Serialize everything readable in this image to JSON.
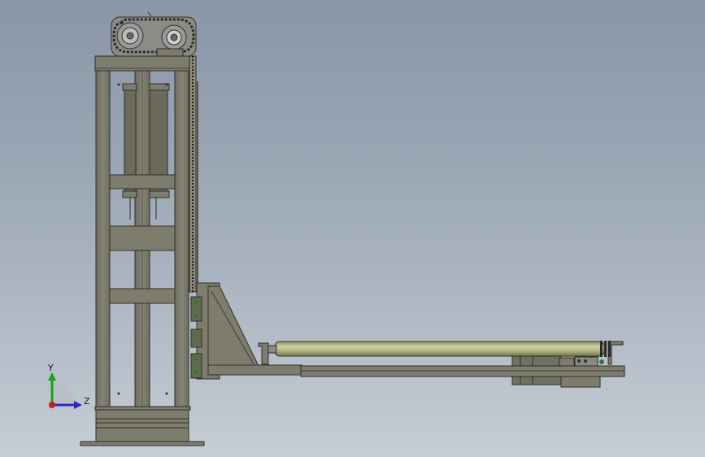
{
  "viewport": {
    "background_top": "#8a96a6",
    "background_bottom": "#c6cdd6"
  },
  "model": {
    "frame_color": "#7e7c6d",
    "frame_edge": "#2f2f2a",
    "roller_color": "#b3b586",
    "sprocket_color": "#9a9a9a"
  },
  "triad": {
    "y_label": "Y",
    "z_label": "Z",
    "y_color": "#16a316",
    "z_color": "#2a2ac8",
    "x_color": "#c81e1e"
  }
}
